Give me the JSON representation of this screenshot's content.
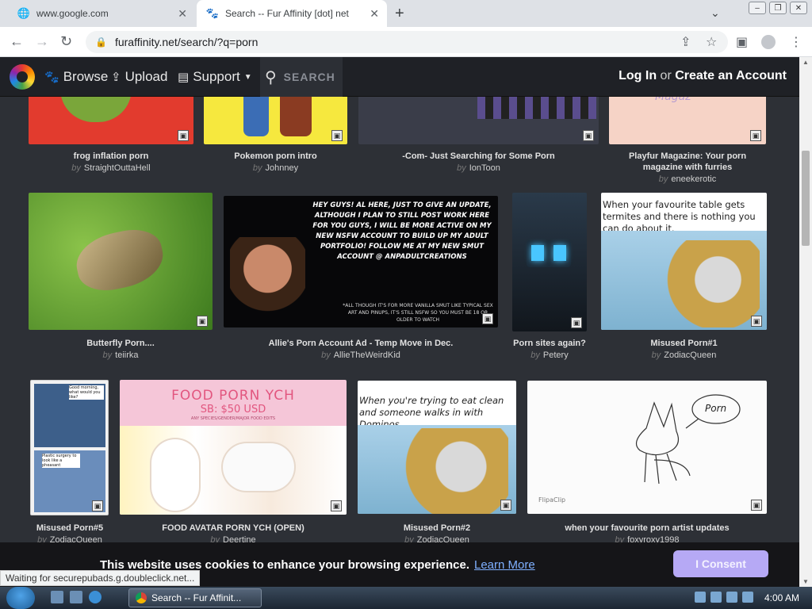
{
  "browser": {
    "tabs": [
      {
        "title": "www.google.com",
        "active": false
      },
      {
        "title": "Search -- Fur Affinity [dot] net",
        "active": true
      }
    ],
    "url": "furaffinity.net/search/?q=porn"
  },
  "site": {
    "nav": {
      "browse": "Browse",
      "upload": "Upload",
      "support": "Support",
      "search_placeholder": "SEARCH"
    },
    "auth": {
      "login": "Log In",
      "or": " or ",
      "create": "Create an Account"
    }
  },
  "results": [
    {
      "title": "frog inflation porn",
      "by": "by",
      "author": "StraightOuttaHell"
    },
    {
      "title": "Pokemon porn intro",
      "by": "by",
      "author": "Johnney"
    },
    {
      "title": "-Com- Just Searching for Some Porn",
      "by": "by",
      "author": "IonToon"
    },
    {
      "title": "Playfur Magazine: Your porn magazine with furries",
      "by": "by",
      "author": "eneekerotic"
    },
    {
      "title": "Butterfly Porn....",
      "by": "by",
      "author": "teiirka"
    },
    {
      "title": "Allie's Porn Account Ad - Temp Move in Dec.",
      "by": "by",
      "author": "AllieTheWeirdKid"
    },
    {
      "title": "Porn sites again?",
      "by": "by",
      "author": "Petery"
    },
    {
      "title": "Misused Porn#1",
      "by": "by",
      "author": "ZodiacQueen"
    },
    {
      "title": "Misused Porn#5",
      "by": "by",
      "author": "ZodiacQueen"
    },
    {
      "title": "FOOD AVATAR PORN YCH (OPEN)",
      "by": "by",
      "author": "Deertine"
    },
    {
      "title": "Misused Porn#2",
      "by": "by",
      "author": "ZodiacQueen"
    },
    {
      "title": "when your favourite porn artist updates",
      "by": "by",
      "author": "foxyroxy1998"
    }
  ],
  "image_text": {
    "allie_ad": "HEY GUYS! AL HERE, JUST TO GIVE AN UPDATE, ALTHOUGH I PLAN TO STILL POST WORK HERE FOR YOU GUYS, I WILL BE MORE ACTIVE ON MY NEW NSFW ACCOUNT TO BUILD UP MY ADULT PORTFOLIO! FOLLOW ME AT MY NEW SMUT ACCOUNT @ ANPADULTCREATIONS",
    "allie_note": "*ALL THOUGH IT'S FOR MORE VANILLA SMUT LIKE TYPICAL SEX ART AND PINUPS, IT'S STILL NSFW SO YOU MUST BE 18 OR OLDER TO WATCH",
    "misused1": "When your favourite table gets termites and there is nothing you can do about it.",
    "misused2": "When you're trying to eat clean and someone walks in with Dominos",
    "food_title": "FOOD PORN YCH",
    "food_price": "SB: $50 USD",
    "food_sub": "ANY SPECIES/GENDER/MAJOR FOOD EDITS",
    "porn_sign": "Porn",
    "flipaclip": "FlipaClip",
    "misused5_caption1": "Good morning, what would you like?",
    "misused5_caption2": "Plastic surgery to look like a pheasant",
    "playfur_script": "Magaz"
  },
  "cookie": {
    "message": "This website uses cookies to enhance your browsing experience.",
    "link": "Learn More",
    "button": "I Consent"
  },
  "status_bar": "Waiting for securepubads.g.doubleclick.net...",
  "taskbar": {
    "window_title": "Search -- Fur Affinit...",
    "clock": "4:00 AM"
  },
  "colors": {
    "header_bg": "#1f2126",
    "gallery_bg": "#2d3036",
    "consent_btn": "#b6a9f5",
    "link": "#7fb0ff"
  }
}
